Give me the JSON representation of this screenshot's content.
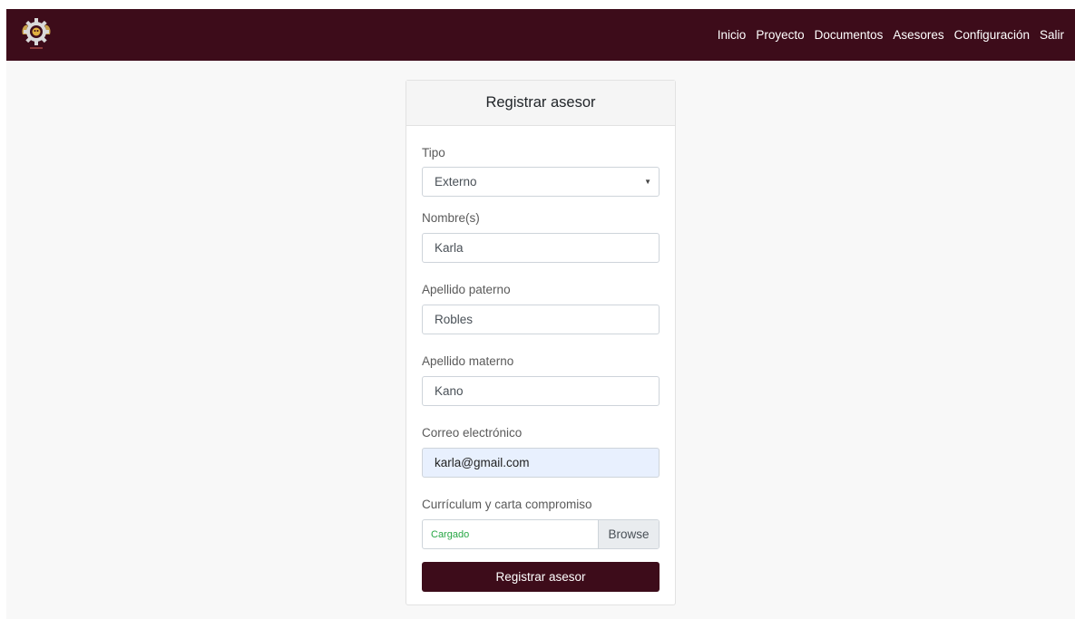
{
  "navbar": {
    "logo_icon": "gear-logo-icon",
    "links": [
      "Inicio",
      "Proyecto",
      "Documentos",
      "Asesores",
      "Configuración",
      "Salir"
    ]
  },
  "form": {
    "title": "Registrar asesor",
    "tipo": {
      "label": "Tipo",
      "value": "Externo"
    },
    "nombre": {
      "label": "Nombre(s)",
      "value": "Karla"
    },
    "apellido_paterno": {
      "label": "Apellido paterno",
      "value": "Robles"
    },
    "apellido_materno": {
      "label": "Apellido materno",
      "value": "Kano"
    },
    "correo": {
      "label": "Correo electrónico",
      "value": "karla@gmail.com"
    },
    "archivo": {
      "label": "Currículum y carta compromiso",
      "status": "Cargado",
      "browse_label": "Browse"
    },
    "submit_label": "Registrar asesor"
  },
  "colors": {
    "brand": "#3d0c1a",
    "success": "#28a745",
    "autofill": "#e8f0fe"
  }
}
